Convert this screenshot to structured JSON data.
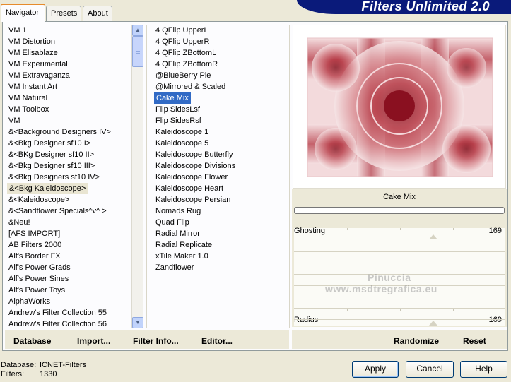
{
  "tabs": [
    "Navigator",
    "Presets",
    "About"
  ],
  "app_title": "Filters Unlimited 2.0",
  "categories": [
    {
      "label": "VM 1"
    },
    {
      "label": "VM Distortion"
    },
    {
      "label": "VM Elisablaze"
    },
    {
      "label": "VM Experimental"
    },
    {
      "label": "VM Extravaganza"
    },
    {
      "label": "VM Instant Art"
    },
    {
      "label": "VM Natural"
    },
    {
      "label": "VM Toolbox"
    },
    {
      "label": "VM"
    },
    {
      "label": "&<Background Designers IV>"
    },
    {
      "label": "&<Bkg Designer sf10 I>"
    },
    {
      "label": "&<BKg Designer sf10 II>"
    },
    {
      "label": "&<Bkg Designer sf10 III>"
    },
    {
      "label": "&<Bkg Designers sf10 IV>"
    },
    {
      "label": "&<Bkg Kaleidoscope>",
      "state": "highlighted"
    },
    {
      "label": "&<Kaleidoscope>"
    },
    {
      "label": "&<Sandflower Specials^v^ >"
    },
    {
      "label": "&Neu!"
    },
    {
      "label": "[AFS IMPORT]"
    },
    {
      "label": "AB Filters 2000"
    },
    {
      "label": "Alf's Border FX"
    },
    {
      "label": "Alf's Power Grads"
    },
    {
      "label": "Alf's Power Sines"
    },
    {
      "label": "Alf's Power Toys"
    },
    {
      "label": "AlphaWorks"
    },
    {
      "label": "Andrew's Filter Collection 55"
    },
    {
      "label": "Andrew's Filter Collection 56"
    }
  ],
  "filters": [
    {
      "label": "4 QFlip UpperL"
    },
    {
      "label": "4 QFlip UpperR"
    },
    {
      "label": "4 QFlip ZBottomL"
    },
    {
      "label": "4 QFlip ZBottomR"
    },
    {
      "label": "@BlueBerry Pie"
    },
    {
      "label": "@Mirrored & Scaled"
    },
    {
      "label": "Cake Mix",
      "state": "selected"
    },
    {
      "label": "Flip SidesLsf"
    },
    {
      "label": "Flip SidesRsf"
    },
    {
      "label": "Kaleidoscope 1"
    },
    {
      "label": "Kaleidoscope 5"
    },
    {
      "label": "Kaleidoscope Butterfly"
    },
    {
      "label": "Kaleidoscope Divisions"
    },
    {
      "label": "Kaleidoscope Flower"
    },
    {
      "label": "Kaleidoscope Heart"
    },
    {
      "label": "Kaleidoscope Persian"
    },
    {
      "label": "Nomads Rug"
    },
    {
      "label": "Quad Flip"
    },
    {
      "label": "Radial Mirror"
    },
    {
      "label": "Radial Replicate"
    },
    {
      "label": "xTile Maker 1.0"
    },
    {
      "label": "Zandflower"
    }
  ],
  "preview": {
    "filter_name": "Cake Mix",
    "watermark_line1": "Pinuccia",
    "watermark_line2": "www.msdtregrafica.eu"
  },
  "sliders": [
    {
      "label": "Ghosting",
      "value": "169"
    },
    {
      "label": "Radius",
      "value": "169"
    }
  ],
  "bottom_links": {
    "database": "Database",
    "import": "Import...",
    "filter_info": "Filter Info...",
    "editor": "Editor...",
    "randomize": "Randomize",
    "reset": "Reset"
  },
  "info": {
    "database_label": "Database:",
    "database_value": "ICNET-Filters",
    "filters_label": "Filters:",
    "filters_value": "1330"
  },
  "buttons": {
    "apply": "Apply",
    "cancel": "Cancel",
    "help": "Help"
  },
  "colors": {
    "banner": "#0a1a7a",
    "selection": "#316ac5",
    "tab_accent": "#e68b2c",
    "preview_red": "#a3202c"
  }
}
